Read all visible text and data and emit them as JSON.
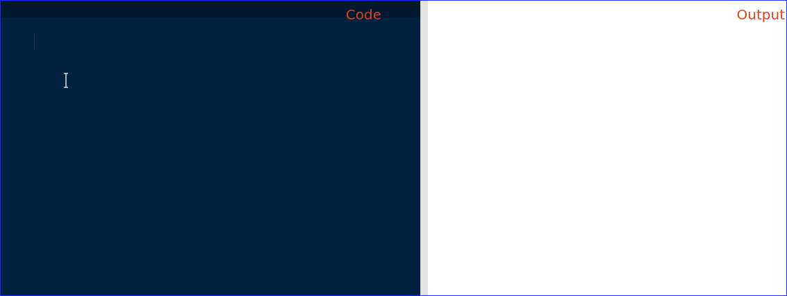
{
  "code_panel": {
    "label": "Code"
  },
  "output_panel": {
    "label": "Output"
  }
}
